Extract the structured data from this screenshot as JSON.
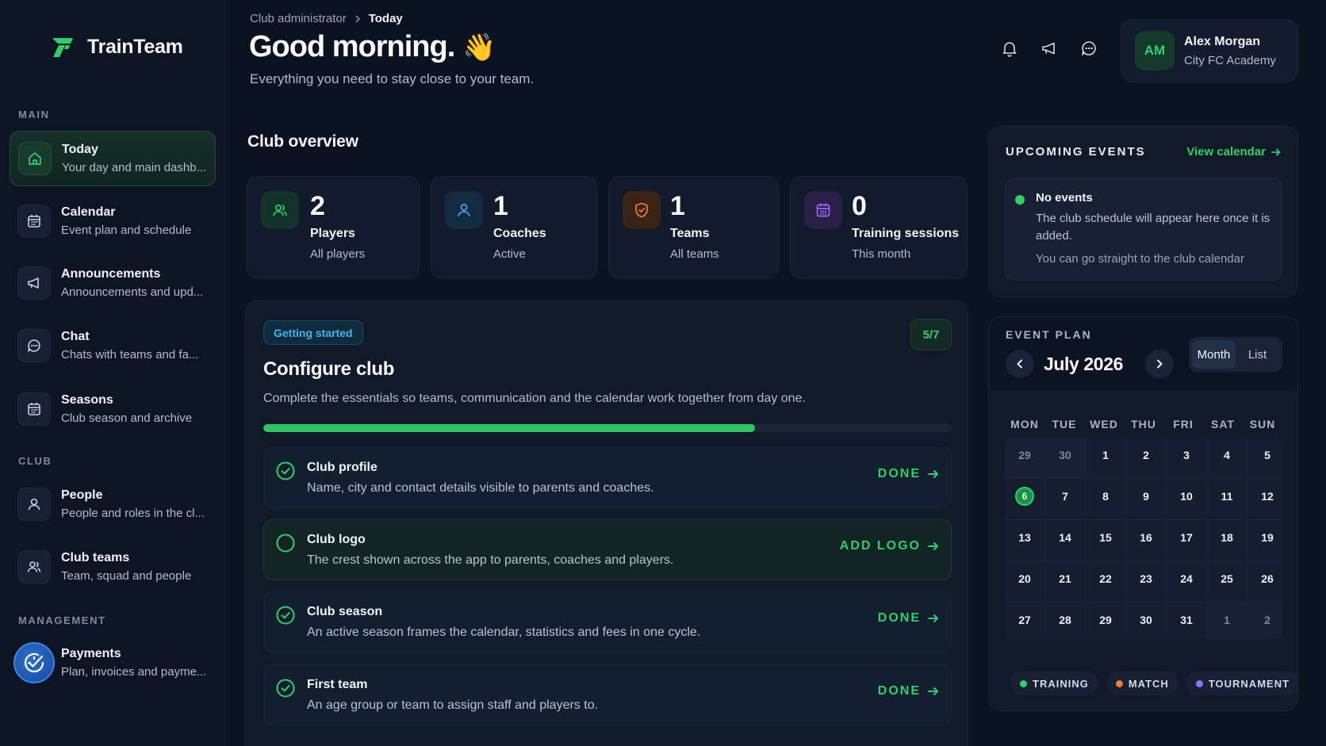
{
  "brand": {
    "name_part1": "Train",
    "name_part2": "Team",
    "accent": "#2fd067"
  },
  "sidebar": {
    "sections": {
      "main": "MAIN",
      "club": "CLUB",
      "management": "MANAGEMENT"
    },
    "items": [
      {
        "title": "Today",
        "subtitle": "Your day and main dashb...",
        "icon": "home-icon",
        "active": true
      },
      {
        "title": "Calendar",
        "subtitle": "Event plan and schedule",
        "icon": "calendar-icon"
      },
      {
        "title": "Announcements",
        "subtitle": "Announcements and upd...",
        "icon": "megaphone-icon"
      },
      {
        "title": "Chat",
        "subtitle": "Chats with teams and fa...",
        "icon": "chat-icon"
      },
      {
        "title": "Seasons",
        "subtitle": "Club season and archive",
        "icon": "calendar-icon"
      },
      {
        "title": "People",
        "subtitle": "People and roles in the cl...",
        "icon": "person-icon"
      },
      {
        "title": "Club teams",
        "subtitle": "Team, squad and people",
        "icon": "people-icon"
      },
      {
        "title": "Payments",
        "subtitle": "Plan, invoices and payme...",
        "icon": "payment-check-icon"
      }
    ]
  },
  "header": {
    "breadcrumb": [
      "Club administrator",
      "Today"
    ],
    "greeting": "Good morning.",
    "greeting_emoji": "👋",
    "tagline": "Everything you need to stay close to your team."
  },
  "user": {
    "initials": "AM",
    "name": "Alex Morgan",
    "club": "City FC Academy"
  },
  "overview": {
    "title": "Club overview",
    "stats": [
      {
        "value": "2",
        "label": "Players",
        "sub": "All players",
        "icon": "people-icon",
        "color": "#2fd067"
      },
      {
        "value": "1",
        "label": "Coaches",
        "sub": "Active",
        "icon": "person-icon",
        "color": "#4aa3f0"
      },
      {
        "value": "1",
        "label": "Teams",
        "sub": "All teams",
        "icon": "shield-icon",
        "color": "#f27a35"
      },
      {
        "value": "0",
        "label": "Training sessions",
        "sub": "This month",
        "icon": "calendar-icon",
        "color": "#9b6cf2"
      }
    ]
  },
  "configure": {
    "chip": "Getting started",
    "progress_label": "5/7",
    "progress_fraction": 0.714,
    "title": "Configure club",
    "description": "Complete the essentials so teams, communication and the calendar work together from day one.",
    "tasks": [
      {
        "title": "Club profile",
        "desc": "Name, city and contact details visible to parents and coaches.",
        "action": "DONE",
        "done": true
      },
      {
        "title": "Club logo",
        "desc": "The crest shown across the app to parents, coaches and players.",
        "action": "ADD LOGO",
        "done": false
      },
      {
        "title": "Club season",
        "desc": "An active season frames the calendar, statistics and fees in one cycle.",
        "action": "DONE",
        "done": true
      },
      {
        "title": "First team",
        "desc": "An age group or team to assign staff and players to.",
        "action": "DONE",
        "done": true
      }
    ]
  },
  "events": {
    "heading": "UPCOMING EVENTS",
    "view_calendar": "View calendar",
    "empty_title": "No events",
    "empty_desc": "The club schedule will appear here once it is added.",
    "empty_link": "You can go straight to the club calendar"
  },
  "plan": {
    "heading": "EVENT PLAN",
    "month": "July 2026",
    "views": [
      "Month",
      "List"
    ],
    "active_view": "Month",
    "weekdays": [
      "MON",
      "TUE",
      "WED",
      "THU",
      "FRI",
      "SAT",
      "SUN"
    ],
    "days": [
      [
        "29",
        "30",
        "1",
        "2",
        "3",
        "4",
        "5"
      ],
      [
        "6",
        "7",
        "8",
        "9",
        "10",
        "11",
        "12"
      ],
      [
        "13",
        "14",
        "15",
        "16",
        "17",
        "18",
        "19"
      ],
      [
        "20",
        "21",
        "22",
        "23",
        "24",
        "25",
        "26"
      ],
      [
        "27",
        "28",
        "29",
        "30",
        "31",
        "1",
        "2"
      ]
    ],
    "today": "6",
    "legend": [
      {
        "label": "TRAINING",
        "color": "#2fd067"
      },
      {
        "label": "MATCH",
        "color": "#f27a35"
      },
      {
        "label": "TOURNAMENT",
        "color": "#9b6cf2"
      }
    ]
  }
}
